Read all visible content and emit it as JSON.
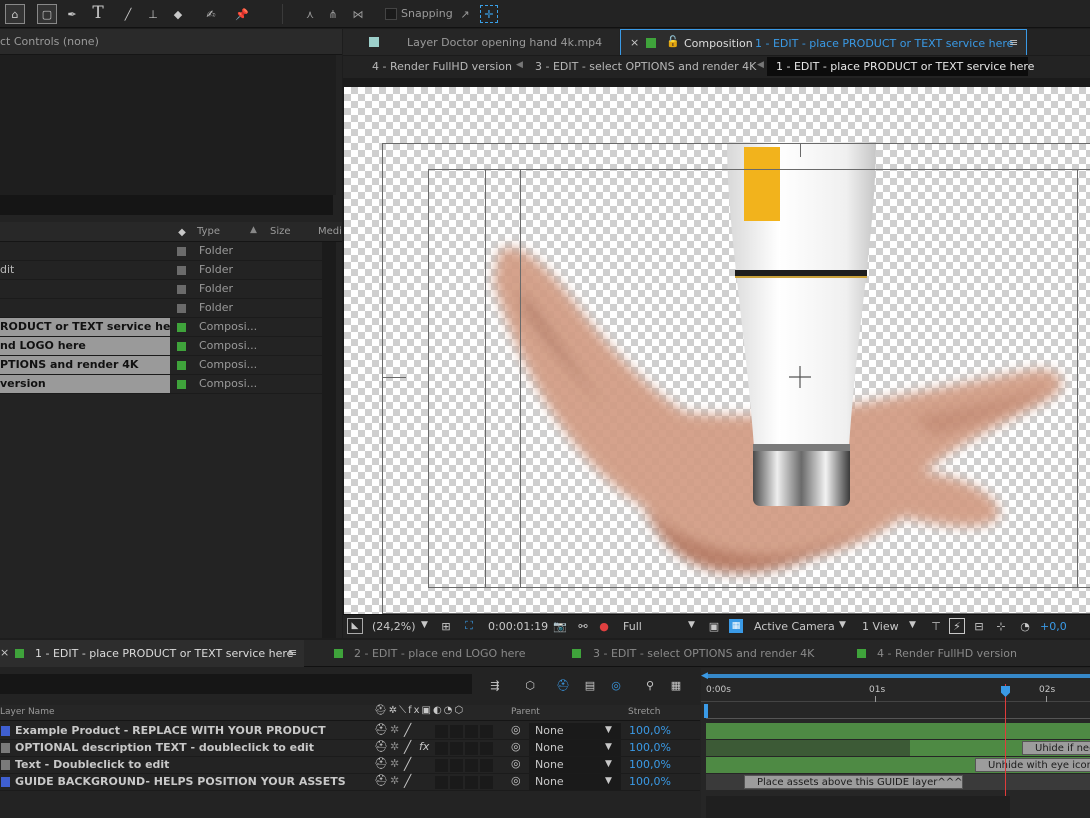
{
  "toolbar": {
    "snapping_label": "Snapping",
    "tools": [
      "home-icon",
      "selection-icon",
      "rectangle-icon",
      "pen-icon",
      "text-icon",
      "brush-icon",
      "clone-stamp-icon",
      "eraser-icon",
      "roto-brush-icon",
      "puppet-pin-icon"
    ]
  },
  "project_panel": {
    "effect_controls_tab": "ct Controls (none)",
    "columns": {
      "type": "Type",
      "size": "Size",
      "media": "Medi"
    },
    "items": [
      {
        "name": "",
        "type": "Folder",
        "color": "#6b6b6b",
        "selected": false
      },
      {
        "name": "dit",
        "type": "Folder",
        "color": "#6b6b6b",
        "selected": false
      },
      {
        "name": "",
        "type": "Folder",
        "color": "#6b6b6b",
        "selected": false
      },
      {
        "name": "",
        "type": "Folder",
        "color": "#6b6b6b",
        "selected": false
      },
      {
        "name": "RODUCT or TEXT service here",
        "type": "Composi...",
        "color": "#3fa33b",
        "selected": true
      },
      {
        "name": "nd LOGO here",
        "type": "Composi...",
        "color": "#3fa33b",
        "selected": true
      },
      {
        "name": "PTIONS and render 4K",
        "type": "Composi...",
        "color": "#3fa33b",
        "selected": true
      },
      {
        "name": "version",
        "type": "Composi...",
        "color": "#3fa33b",
        "selected": true
      }
    ]
  },
  "viewer": {
    "layer_tab": "Layer  Doctor opening hand 4k.mp4",
    "comp_tab_prefix": "Composition",
    "comp_tab_name": "1 - EDIT -  place PRODUCT or TEXT service here",
    "breadcrumbs": [
      "4 - Render FullHD version",
      "3 - EDIT - select OPTIONS and render 4K",
      "1 - EDIT -  place PRODUCT or TEXT service here"
    ],
    "footer": {
      "zoom": "(24,2%)",
      "timecode": "0:00:01:19",
      "resolution": "Full",
      "camera": "Active Camera",
      "views": "1 View",
      "exposure": "+0,0"
    }
  },
  "timeline": {
    "tabs": [
      {
        "label": "1 - EDIT -  place PRODUCT or TEXT service here",
        "active": true
      },
      {
        "label": "2 - EDIT -  place end LOGO here",
        "active": false
      },
      {
        "label": "3 - EDIT - select OPTIONS and render 4K",
        "active": false
      },
      {
        "label": "4 - Render FullHD version",
        "active": false
      }
    ],
    "columns": {
      "layer_name": "Layer Name",
      "parent": "Parent",
      "stretch": "Stretch"
    },
    "ruler": [
      "0:00s",
      "01s",
      "02s"
    ],
    "layers": [
      {
        "name": "Example Product - REPLACE WITH YOUR PRODUCT",
        "parent": "None",
        "stretch": "100,0%",
        "color": "#3f5fd0"
      },
      {
        "name": "OPTIONAL description TEXT - doubleclick to edit",
        "parent": "None",
        "stretch": "100,0%",
        "color": "#7a7a7a"
      },
      {
        "name": "Text - Doubleclick to edit",
        "parent": "None",
        "stretch": "100,0%",
        "color": "#7a7a7a"
      },
      {
        "name": "GUIDE BACKGROUND- HELPS POSITION YOUR ASSETS",
        "parent": "None",
        "stretch": "100,0%",
        "color": "#3f5fd0"
      }
    ],
    "markers": [
      "Uhide if nee",
      "Unhide with eye icon at",
      "Place assets above this GUIDE layer^^^"
    ]
  }
}
